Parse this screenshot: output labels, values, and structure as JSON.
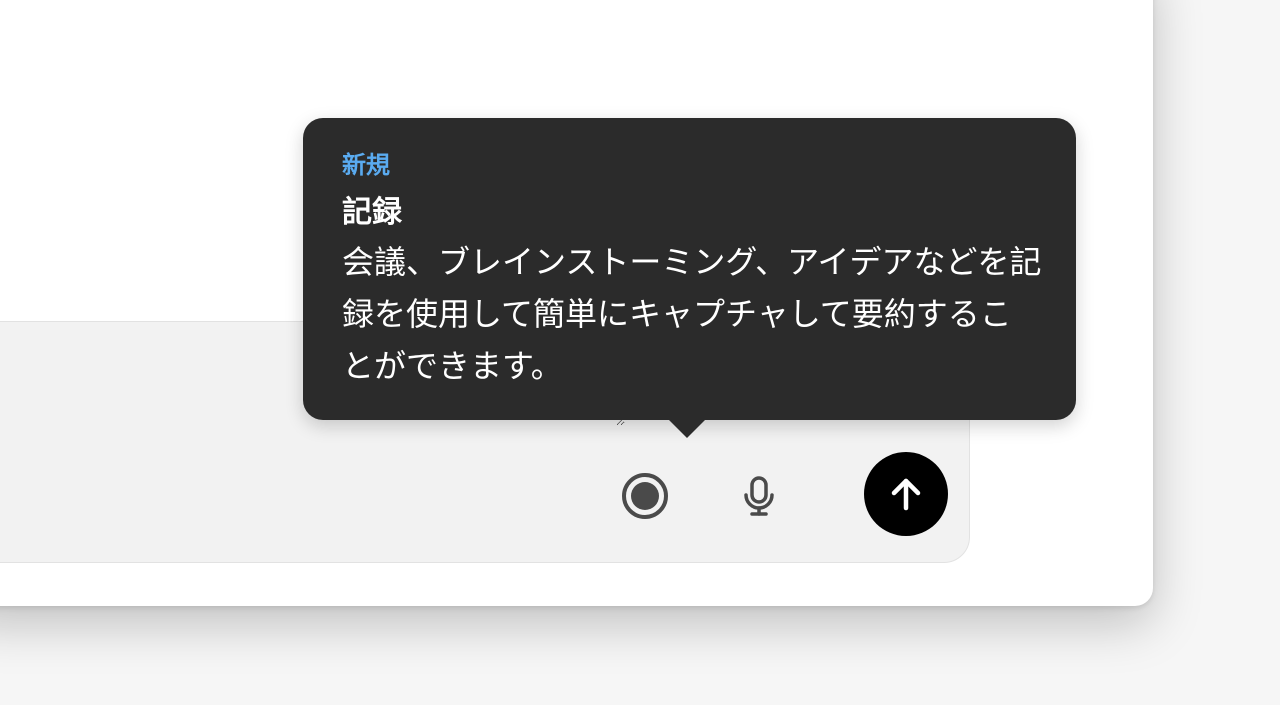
{
  "colors": {
    "tooltip_background": "#2b2b2b",
    "badge": "#5aabf0",
    "tooltip_text": "#ffffff",
    "send_button": "#000000",
    "icon": "#4a4a4a"
  },
  "composer": {
    "placeholder": ""
  },
  "tooltip": {
    "badge": "新規",
    "title": "記録",
    "body": "会議、ブレインストーミング、アイデアなどを記録を使用して簡単にキャプチャして要約することができます。"
  },
  "toolbar": {
    "icons": [
      "record-icon",
      "microphone-icon",
      "arrow-up-icon"
    ]
  }
}
